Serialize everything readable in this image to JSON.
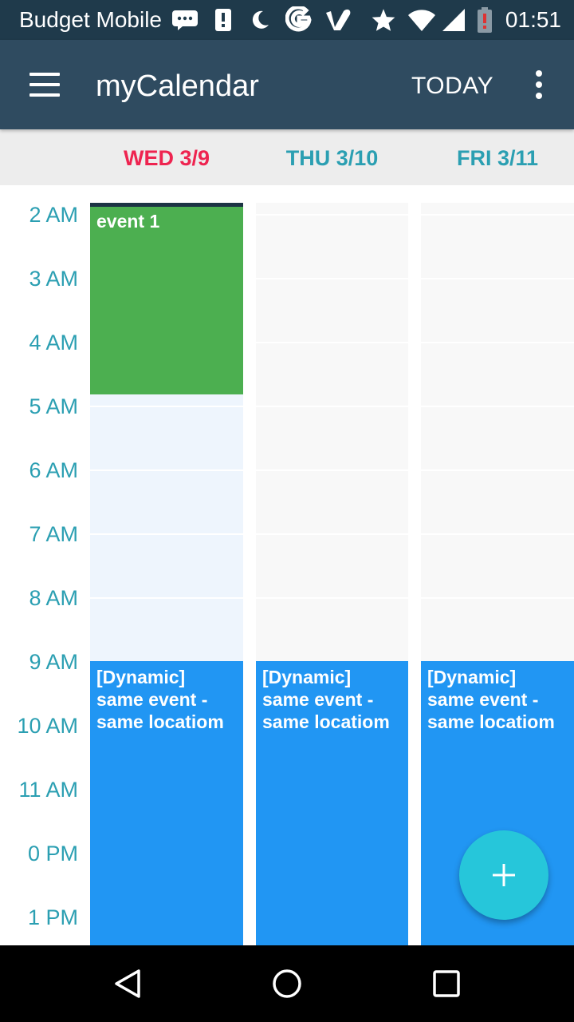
{
  "status_bar": {
    "carrier": "Budget Mobile",
    "time": "01:51",
    "icons": [
      "message-icon",
      "alert-icon",
      "moon-icon",
      "google-icon",
      "vimeo-icon",
      "star-icon",
      "wifi-icon",
      "signal-icon",
      "battery-low-icon"
    ]
  },
  "app_bar": {
    "title": "myCalendar",
    "today_label": "TODAY",
    "menu_icon": "hamburger-menu-icon",
    "more_icon": "more-vert-icon"
  },
  "days": [
    {
      "label": "WED 3/9",
      "is_today": true
    },
    {
      "label": "THU 3/10",
      "is_today": false
    },
    {
      "label": "FRI 3/11",
      "is_today": false
    }
  ],
  "hours": [
    "2 AM",
    "3 AM",
    "4 AM",
    "5 AM",
    "6 AM",
    "7 AM",
    "8 AM",
    "9 AM",
    "10 AM",
    "11 AM",
    "0 PM",
    "1 PM"
  ],
  "events": {
    "event1": {
      "title": "event 1"
    },
    "dynamic": [
      {
        "title": "[Dynamic] same event - same locatiom"
      },
      {
        "title": "[Dynamic] same event - same locatiom"
      },
      {
        "title": "[Dynamic] same event - same locatiom"
      }
    ]
  },
  "colors": {
    "status_bar": "#1f3a4b",
    "app_bar": "#2f4b60",
    "today_text": "#ee2450",
    "day_text": "#2b9fb2",
    "event_green": "#4caf50",
    "event_blue": "#2196f3",
    "fab": "#26c6da"
  },
  "fab": {
    "icon": "plus-icon"
  },
  "nav": {
    "back_icon": "back-triangle-icon",
    "home_icon": "home-circle-icon",
    "recents_icon": "recents-square-icon"
  }
}
